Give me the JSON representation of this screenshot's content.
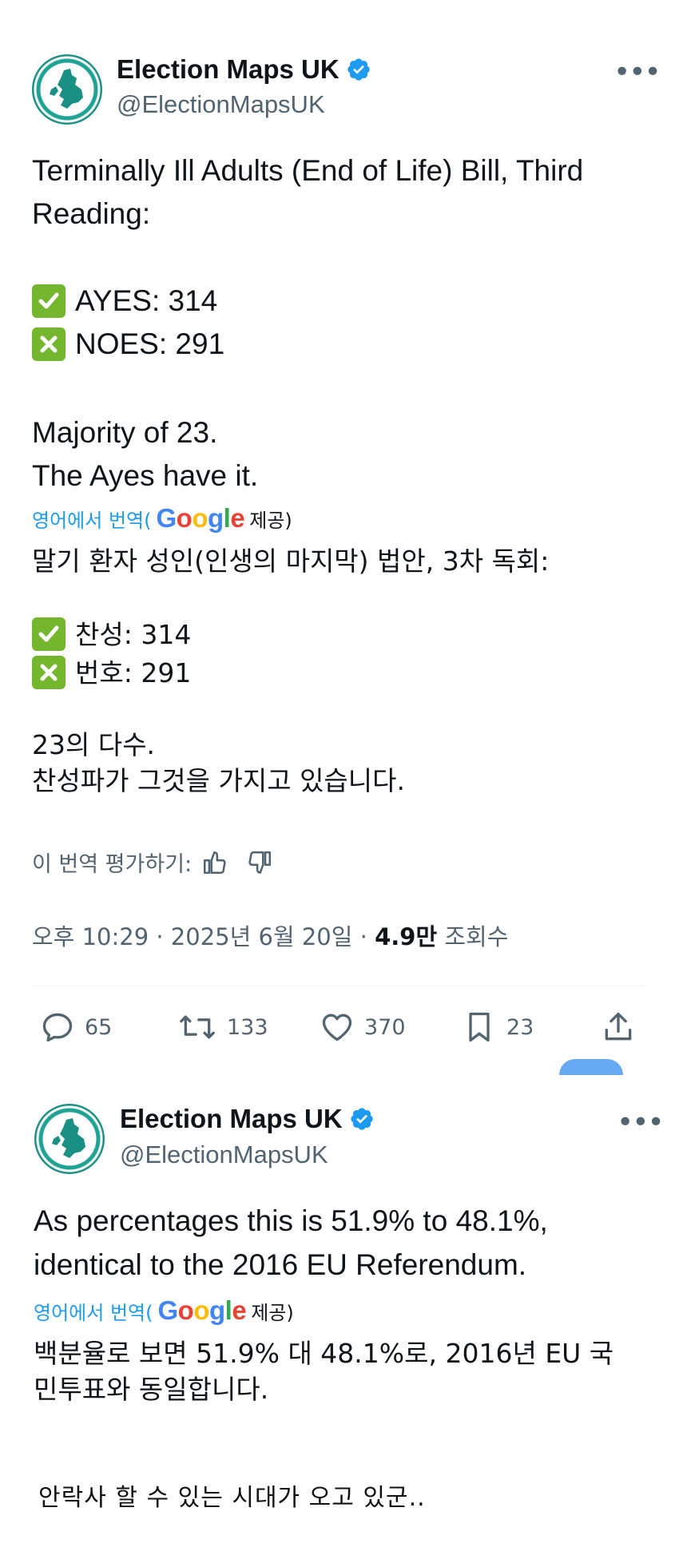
{
  "tweets": [
    {
      "author": {
        "name": "Election Maps UK",
        "handle": "@ElectionMapsUK"
      },
      "text_lines": [
        "Terminally Ill Adults (End of Life) Bill, Third",
        "Reading:",
        "AYES: 314",
        "NOES: 291",
        "Majority of 23.",
        "The Ayes have it."
      ],
      "translate": {
        "link": "영어에서 번역(",
        "google": "Google",
        "provided": "제공)"
      },
      "translated_lines": [
        "말기 환자 성인(인생의 마지막) 법안, 3차 독회:",
        "찬성: 314",
        "번호: 291",
        "23의 다수.",
        "찬성파가 그것을 가지고 있습니다."
      ],
      "rate_label": "이 번역 평가하기:",
      "meta": {
        "time": "오후 10:29 · 2025년 6월 20일 · ",
        "views": "4.9만",
        "views_label": " 조회수"
      },
      "actions": {
        "replies": "65",
        "reposts": "133",
        "likes": "370",
        "bookmarks": "23"
      }
    },
    {
      "author": {
        "name": "Election Maps UK",
        "handle": "@ElectionMapsUK"
      },
      "text_lines": [
        "As percentages this is 51.9% to 48.1%,",
        "identical to the 2016 EU Referendum."
      ],
      "translate": {
        "link": "영어에서 번역(",
        "google": "Google",
        "provided": "제공)"
      },
      "translated_lines": [
        "백분율로 보면 51.9% 대 48.1%로, 2016년 EU 국",
        "민투표와 동일합니다."
      ]
    }
  ],
  "comment": "안락사 할 수 있는 시대가 오고 있군..",
  "colors": {
    "accent": "#1d9bf0",
    "check": "#74b72e",
    "muted": "#536471"
  }
}
